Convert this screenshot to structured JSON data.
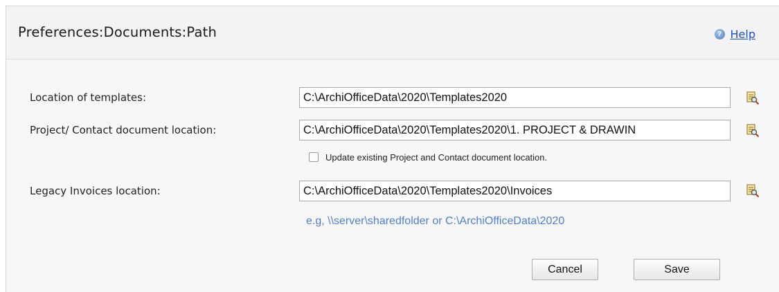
{
  "header": {
    "title": "Preferences:Documents:Path",
    "help_label": "Help"
  },
  "form": {
    "templates_label": "Location of templates:",
    "templates_value": "C:\\ArchiOfficeData\\2020\\Templates2020",
    "project_label": "Project/ Contact document location:",
    "project_value": "C:\\ArchiOfficeData\\2020\\Templates2020\\1. PROJECT & DRAWIN",
    "update_checkbox_label": "Update existing Project and Contact document location.",
    "update_checkbox_checked": false,
    "invoices_label": "Legacy Invoices location:",
    "invoices_value": "C:\\ArchiOfficeData\\2020\\Templates2020\\Invoices",
    "hint": "e.g, \\\\server\\sharedfolder or C:\\ArchiOfficeData\\2020"
  },
  "buttons": {
    "cancel": "Cancel",
    "save": "Save"
  },
  "icons": {
    "help": "help-icon",
    "browse": "folder-browse-icon"
  },
  "colors": {
    "link": "#1a4fd6",
    "hint": "#4f7fd4"
  }
}
